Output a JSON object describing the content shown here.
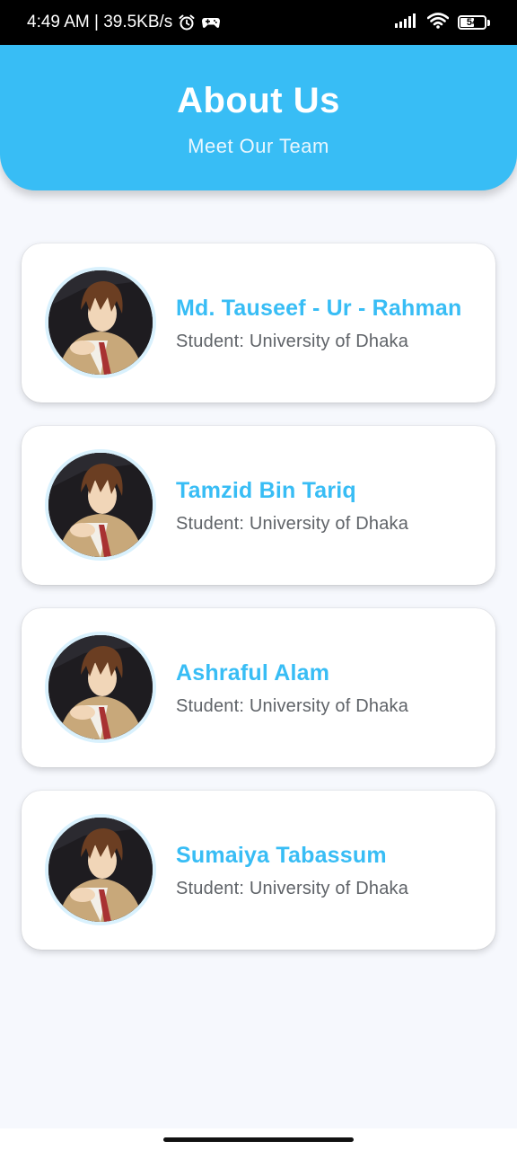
{
  "status_bar": {
    "time_speed": "4:49 AM | 39.5KB/s",
    "battery_level": "54",
    "icons": [
      "alarm-icon",
      "game-controller-icon",
      "signal-icon",
      "wifi-icon",
      "battery-icon"
    ]
  },
  "header": {
    "title": "About Us",
    "subtitle": "Meet Our Team"
  },
  "team": [
    {
      "name": "Md. Tauseef - Ur - Rahman",
      "role": "Student: University of Dhaka"
    },
    {
      "name": "Tamzid Bin Tariq",
      "role": "Student: University of Dhaka"
    },
    {
      "name": "Ashraful Alam",
      "role": "Student: University of Dhaka"
    },
    {
      "name": "Sumaiya Tabassum",
      "role": "Student: University of Dhaka"
    }
  ],
  "colors": {
    "accent": "#38bdf5",
    "background": "#f6f8fd",
    "card": "#ffffff",
    "secondary_text": "#5f6368"
  }
}
